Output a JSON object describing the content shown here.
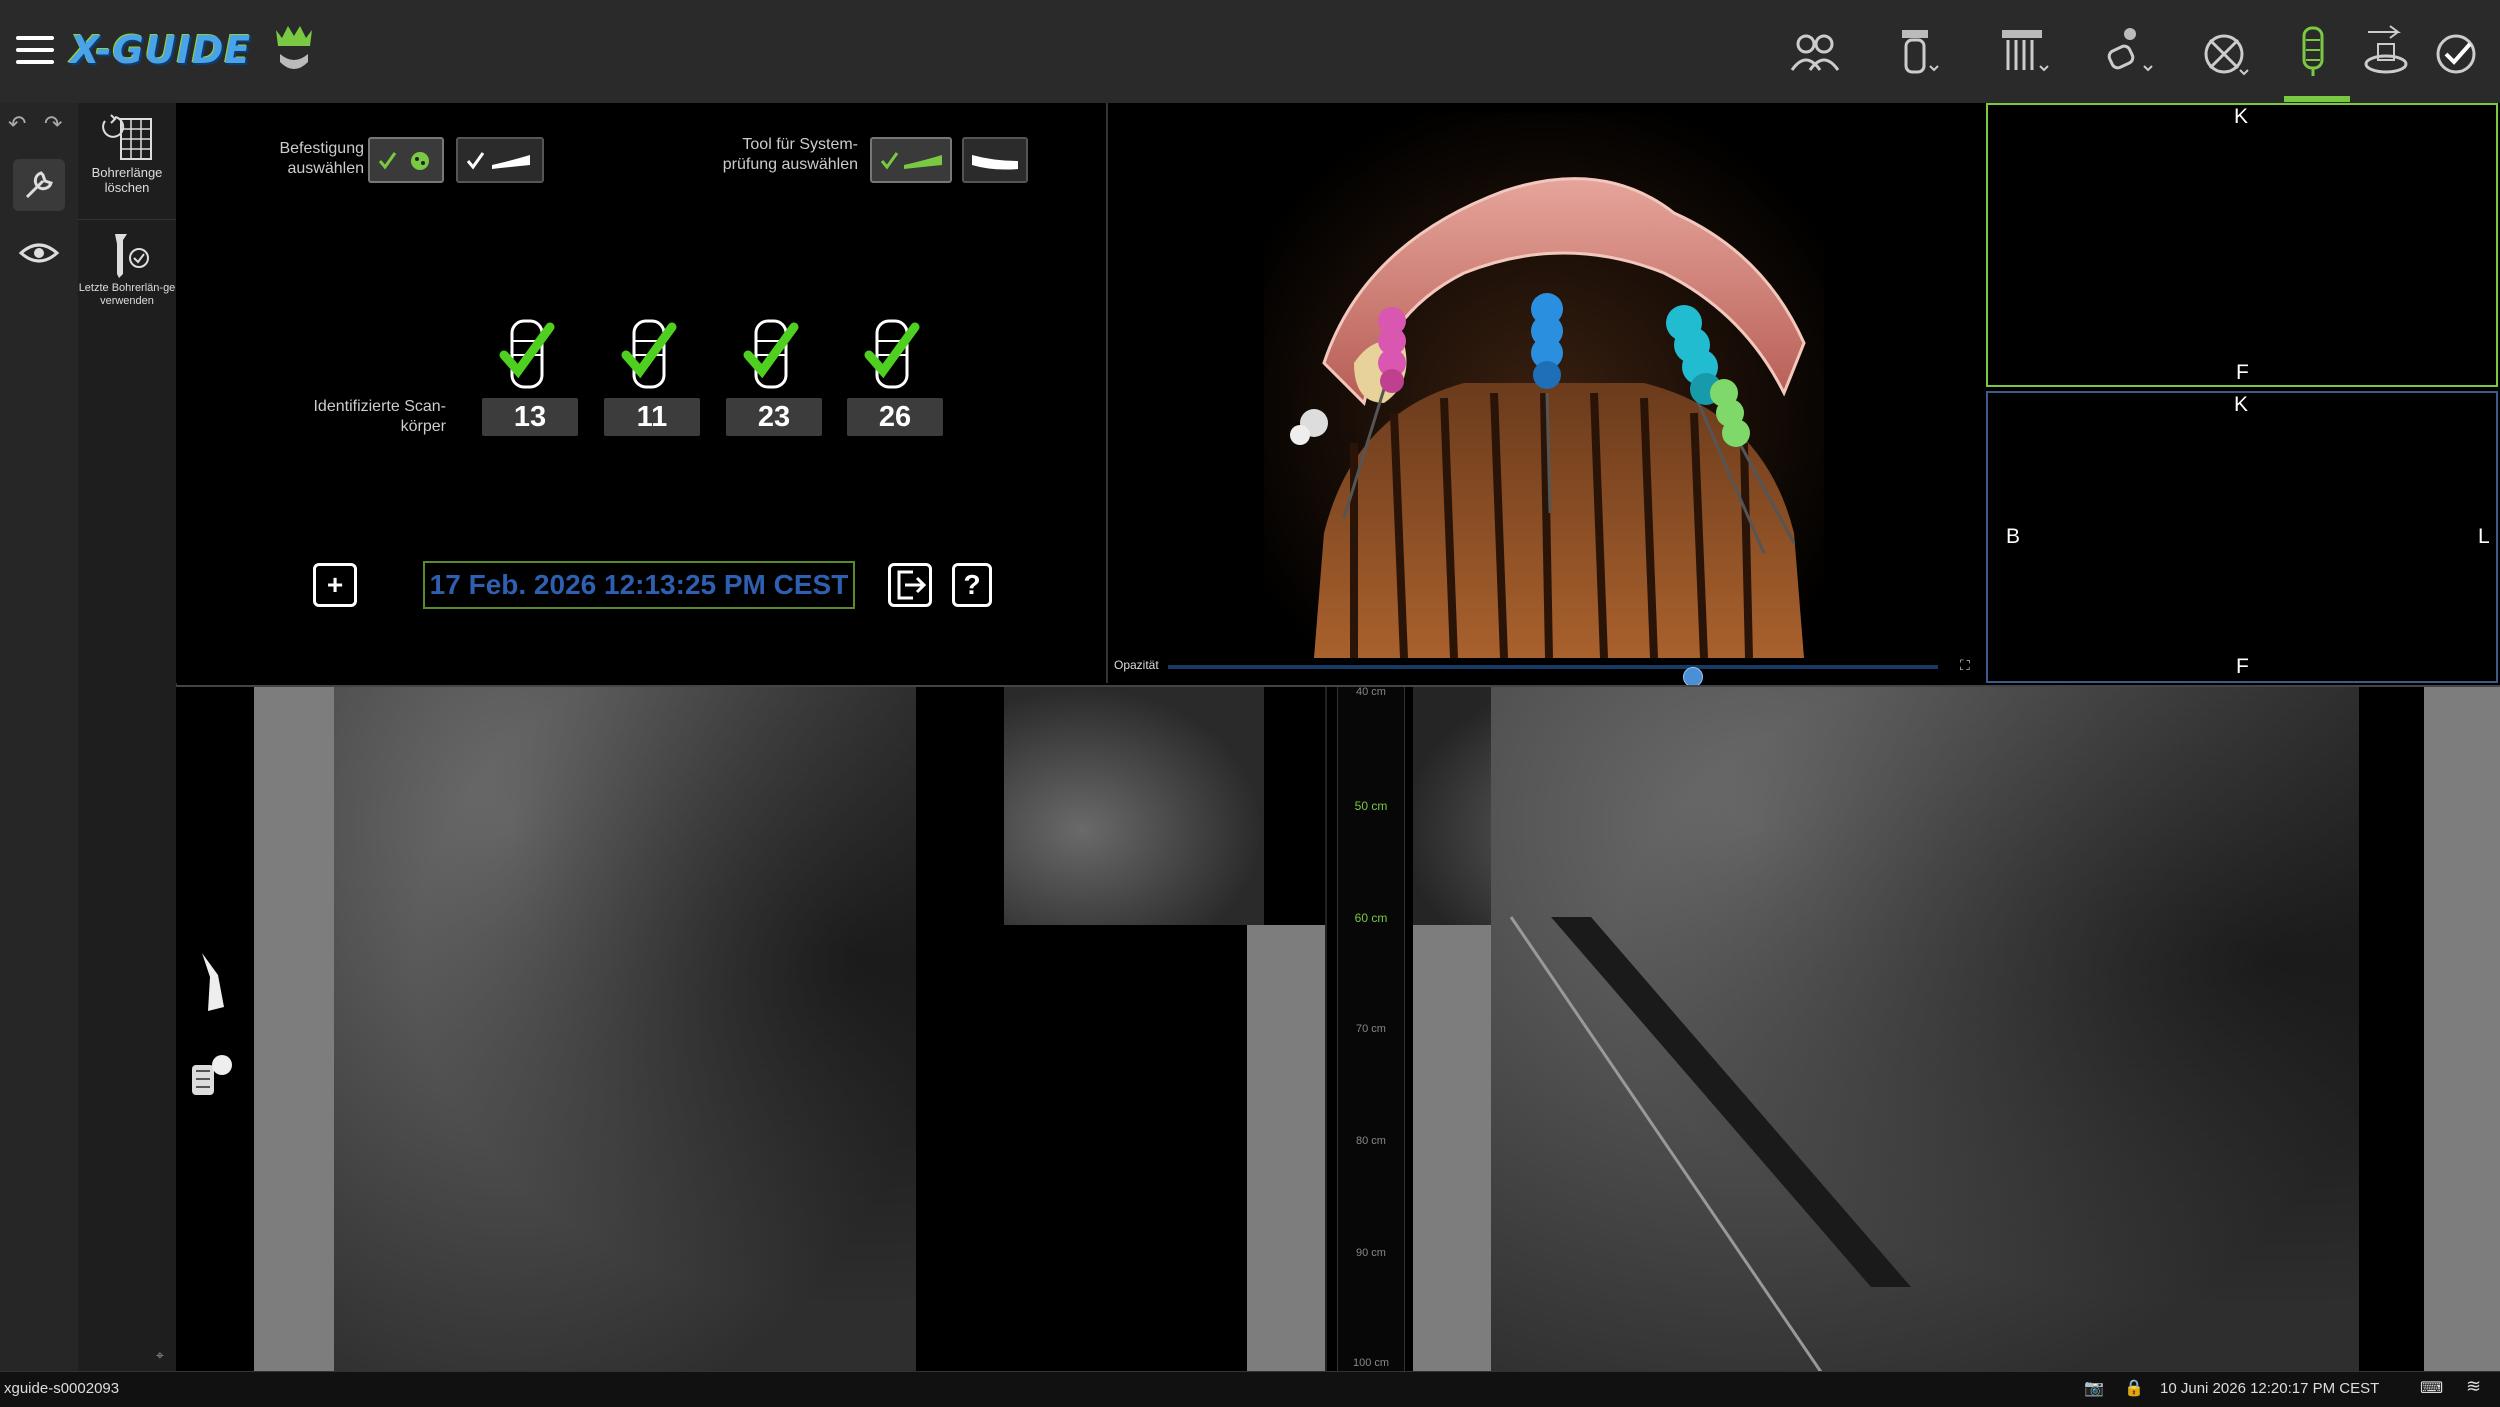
{
  "app": {
    "logo_text": "X-GUIDE"
  },
  "topbar": {
    "menu_icon": "hamburger-icon",
    "icons": [
      "patients-icon",
      "scan-body-icon",
      "implant-plan-icon",
      "tracer-icon",
      "calibration-icon",
      "scan-body-id-icon",
      "drill-icon",
      "finish-icon"
    ],
    "active_step": "scan-body-id-icon"
  },
  "left_rail": {
    "undo_icon": "undo-icon",
    "redo_icon": "redo-icon",
    "tool_icon": "wrench-icon",
    "view_icon": "eye-icon"
  },
  "tools": {
    "clear_drill_length": "Bohrerlänge löschen",
    "use_last_drill_length": "Letzte Bohrerlän-ge verwenden"
  },
  "setup": {
    "attachment_label": "Befestigung auswählen",
    "system_check_label": "Tool für System-prüfung auswählen",
    "identified_label": "Identifizierte Scan-körper",
    "scan_bodies": [
      "13",
      "11",
      "23",
      "26"
    ],
    "timestamp": "17 Feb. 2026 12:13:25 PM CEST",
    "add_button": "+",
    "help_button": "?"
  },
  "view3d": {
    "opacity_label": "Opazität",
    "opacity_value": 0.68
  },
  "ortho_top": {
    "top": "K",
    "bottom": "F"
  },
  "ortho_bottom": {
    "top": "K",
    "bottom": "F",
    "left": "B",
    "right": "L"
  },
  "ruler": [
    "40 cm",
    "50 cm",
    "60 cm",
    "70 cm",
    "80 cm",
    "90 cm",
    "100 cm"
  ],
  "ruler_highlight": [
    "50 cm",
    "60 cm"
  ],
  "status": {
    "host": "xguide-s0002093",
    "datetime": "10 Juni 2026 12:20:17 PM CEST"
  },
  "colors": {
    "accent_green": "#7ac943",
    "date_blue": "#2f5fb0"
  }
}
